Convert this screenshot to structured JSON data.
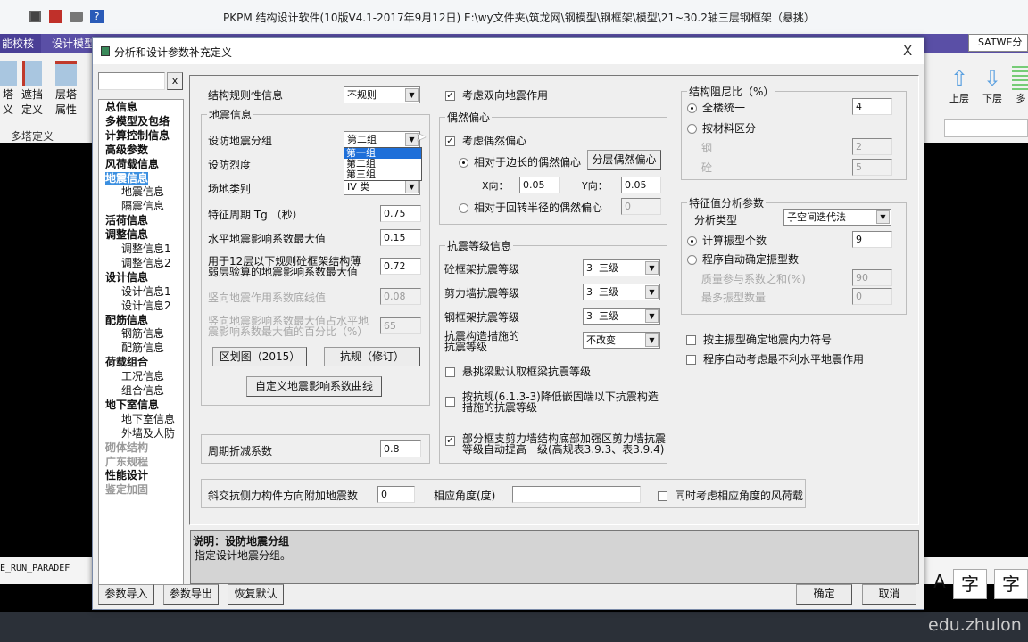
{
  "app": {
    "title": "PKPM 结构设计软件(10版V4.1-2017年9月12日) E:\\wy文件夹\\筑龙网\\钢模型\\钢框架\\模型\\21~30.2轴三层钢框架（悬挑）",
    "tabs": [
      "能校核",
      "设计模型"
    ],
    "ribbon_items": [
      {
        "l1": "塔",
        "l2": "义"
      },
      {
        "l1": "遮挡",
        "l2": "定义"
      },
      {
        "l1": "层塔",
        "l2": "属性"
      }
    ],
    "ribbon_group": "多塔定义",
    "right_select": "SATWE分",
    "right_buttons": [
      "上层",
      "下层",
      "多"
    ],
    "status_text": "E_RUN_PARADEF",
    "bottom_icons": [
      "A",
      "字",
      "字"
    ],
    "watermark": "edu.zhulon",
    "accent": "#5a4fa6"
  },
  "dialog": {
    "title": "分析和设计参数补充定义",
    "close": "X",
    "search_clear": "x",
    "tree": [
      {
        "label": "总信息",
        "level": 0
      },
      {
        "label": "多模型及包络",
        "level": 0
      },
      {
        "label": "计算控制信息",
        "level": 0
      },
      {
        "label": "高级参数",
        "level": 0
      },
      {
        "label": "风荷载信息",
        "level": 0
      },
      {
        "label": "地震信息",
        "level": 0,
        "selected": true
      },
      {
        "label": "地震信息",
        "level": 1
      },
      {
        "label": "隔震信息",
        "level": 1
      },
      {
        "label": "活荷信息",
        "level": 0
      },
      {
        "label": "调整信息",
        "level": 0
      },
      {
        "label": "调整信息1",
        "level": 1
      },
      {
        "label": "调整信息2",
        "level": 1
      },
      {
        "label": "设计信息",
        "level": 0
      },
      {
        "label": "设计信息1",
        "level": 1
      },
      {
        "label": "设计信息2",
        "level": 1
      },
      {
        "label": "配筋信息",
        "level": 0
      },
      {
        "label": "钢筋信息",
        "level": 1
      },
      {
        "label": "配筋信息",
        "level": 1
      },
      {
        "label": "荷载组合",
        "level": 0
      },
      {
        "label": "工况信息",
        "level": 1
      },
      {
        "label": "组合信息",
        "level": 1
      },
      {
        "label": "地下室信息",
        "level": 0
      },
      {
        "label": "地下室信息",
        "level": 1
      },
      {
        "label": "外墙及人防",
        "level": 1
      },
      {
        "label": "砌体结构",
        "level": 0,
        "disabled": true
      },
      {
        "label": "广东规程",
        "level": 0,
        "disabled": true
      },
      {
        "label": "性能设计",
        "level": 0
      },
      {
        "label": "鉴定加固",
        "level": 0,
        "disabled": true
      }
    ],
    "left": {
      "regularity_label": "结构规则性信息",
      "regularity_value": "不规则",
      "eq_group_title": "地震信息",
      "group_label": "设防地震分组",
      "group_value": "第二组",
      "group_options": [
        "第一组",
        "第二组",
        "第三组"
      ],
      "intensity_label": "设防烈度",
      "site_label": "场地类别",
      "site_value": "IV 类",
      "tg_label": "特征周期 Tg （秒）",
      "tg_value": "0.75",
      "amax_label": "水平地震影响系数最大值",
      "amax_value": "0.15",
      "weak_label": "用于12层以下规则砼框架结构薄弱层验算的地震影响系数最大值",
      "weak_value": "0.72",
      "vert_label": "竖向地震作用系数底线值",
      "vert_value": "0.08",
      "vert_pct_label": "竖向地震影响系数最大值占水平地震影响系数最大值的百分比（%）",
      "vert_pct_value": "65",
      "btn_zone": "区划图（2015）",
      "btn_code": "抗规（修订）",
      "btn_curve": "自定义地震影响系数曲线",
      "period_label": "周期折减系数",
      "period_value": "0.8",
      "oblique_label": "斜交抗侧力构件方向附加地震数",
      "oblique_value": "0",
      "angle_label": "相应角度(度)",
      "angle_value": "",
      "wind_label": "同时考虑相应角度的风荷载",
      "wind_checked": false
    },
    "middle": {
      "bidir_label": "考虑双向地震作用",
      "bidir_checked": true,
      "ecc_title": "偶然偏心",
      "ecc_label": "考虑偶然偏心",
      "ecc_checked": true,
      "side_label": "相对于边长的偶然偏心",
      "side_selected": true,
      "btn_layer": "分层偶然偏心",
      "x_label": "X向：",
      "x_value": "0.05",
      "y_label": "Y向：",
      "y_value": "0.05",
      "gyr_label": "相对于回转半径的偶然偏心",
      "gyr_value": "0",
      "grade_title": "抗震等级信息",
      "grades": [
        {
          "label": "砼框架抗震等级",
          "value": "3  三级"
        },
        {
          "label": "剪力墙抗震等级",
          "value": "3  三级"
        },
        {
          "label": "钢框架抗震等级",
          "value": "3  三级"
        }
      ],
      "measure_label": "抗震构造措施的抗震等级",
      "measure_value": "不改变",
      "cb1_label": "悬挑梁默认取框梁抗震等级",
      "cb1_checked": false,
      "cb2_label": "按抗规(6.1.3-3)降低嵌固端以下抗震构造措施的抗震等级",
      "cb2_checked": false,
      "cb3_label": "部分框支剪力墙结构底部加强区剪力墙抗震等级自动提高一级(高规表3.9.3、表3.9.4)",
      "cb3_checked": true
    },
    "right": {
      "damp_title": "结构阻尼比（%）",
      "damp_all_label": "全楼统一",
      "damp_all_value": "4",
      "damp_all_selected": true,
      "damp_mat_label": "按材料区分",
      "steel_label": "钢",
      "steel_value": "2",
      "conc_label": "砼",
      "conc_value": "5",
      "eig_title": "特征值分析参数",
      "type_label": "分析类型",
      "type_value": "子空间迭代法",
      "modes_label": "计算振型个数",
      "modes_value": "9",
      "modes_selected": true,
      "auto_label": "程序自动确定振型数",
      "mass_label": "质量参与系数之和(%)",
      "mass_value": "90",
      "max_label": "最多振型数量",
      "max_value": "0",
      "cb1_label": "按主振型确定地震内力符号",
      "cb1_checked": false,
      "cb2_label": "程序自动考虑最不利水平地震作用",
      "cb2_checked": false
    },
    "desc_title": "说明：设防地震分组",
    "desc_text": "指定设计地震分组。",
    "buttons": {
      "import": "参数导入",
      "export": "参数导出",
      "reset": "恢复默认",
      "ok": "确定",
      "cancel": "取消"
    }
  }
}
